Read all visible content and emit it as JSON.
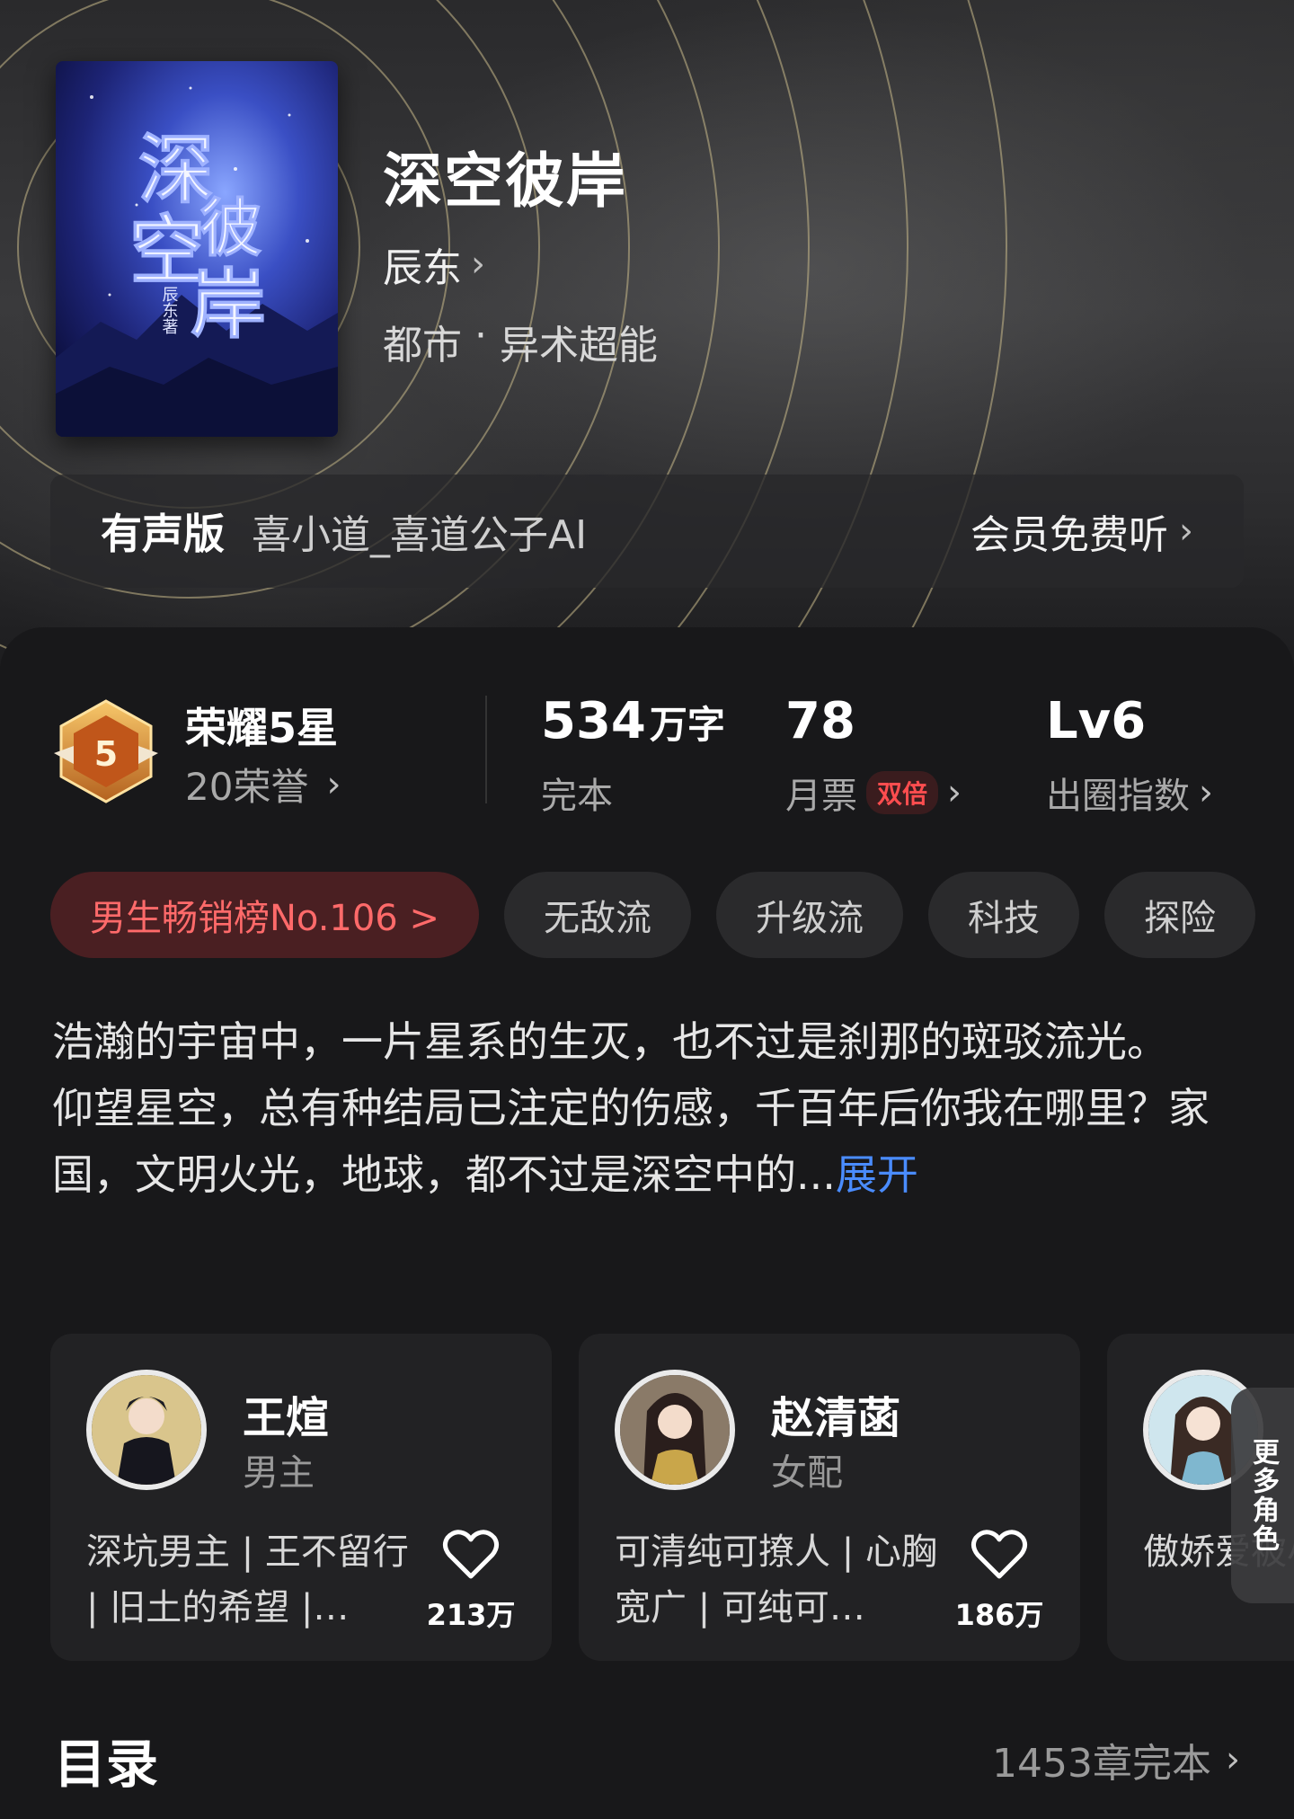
{
  "book": {
    "title": "深空彼岸",
    "author": "辰东",
    "genre_main": "都市",
    "genre_sep": "·",
    "genre_sub": "异术超能",
    "cover_title_lines": [
      "深",
      "空",
      "彼",
      "岸"
    ],
    "cover_author": "辰东著"
  },
  "audio": {
    "label": "有声版",
    "narrator": "喜小道_喜道公子AI",
    "action": "会员免费听"
  },
  "honor": {
    "title": "荣耀5星",
    "sub": "20荣誉",
    "badge_number": "5"
  },
  "stats": {
    "words_value": "534",
    "words_unit": "万字",
    "words_label": "完本",
    "votes_value": "78",
    "votes_label": "月票",
    "votes_badge": "双倍",
    "level_value": "Lv6",
    "level_label": "出圈指数"
  },
  "tags": {
    "rank": "男生畅销榜No.106 >",
    "items": [
      "无敌流",
      "升级流",
      "科技",
      "探险"
    ]
  },
  "description": {
    "para1": "浩瀚的宇宙中，一片星系的生灭，也不过是刹那的斑驳流光。",
    "para2": "仰望星空，总有种结局已注定的伤感，千百年后你我在哪里？家国，文明火光，地球，都不过是深空中的...",
    "expand": "展开"
  },
  "roles": [
    {
      "name": "王煊",
      "type": "男主",
      "desc": "深坑男主 | 王不留行 | 旧土的希望 |…",
      "likes": "213万"
    },
    {
      "name": "赵清菡",
      "type": "女配",
      "desc": "可清纯可撩人 | 心胸宽广 | 可纯可…",
      "likes": "186万"
    },
    {
      "name": "",
      "type": "",
      "desc": "傲娇爱被小姐姐 |",
      "likes": ""
    }
  ],
  "more_roles": "更多角色",
  "toc": {
    "title": "目录",
    "info": "1453章完本"
  }
}
